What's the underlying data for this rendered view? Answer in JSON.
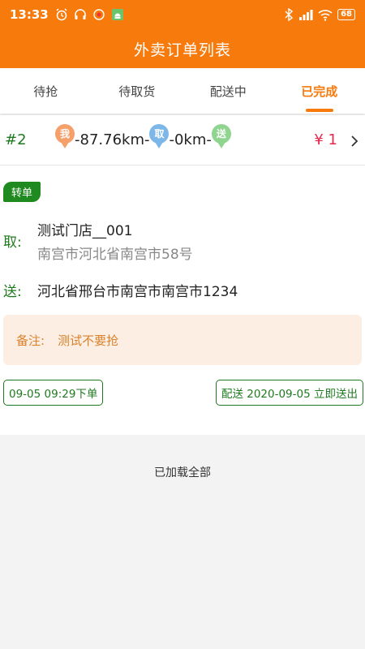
{
  "status_bar": {
    "time": "13:33",
    "battery": "68",
    "icons": [
      "alarm-icon",
      "headphones-icon",
      "notification-icon",
      "android-icon",
      "bluetooth-icon",
      "signal-icon",
      "wifi-icon",
      "battery-icon"
    ]
  },
  "app_bar": {
    "title": "外卖订单列表"
  },
  "tabs": [
    {
      "label": "待抢",
      "active": false
    },
    {
      "label": "待取货",
      "active": false
    },
    {
      "label": "配送中",
      "active": false
    },
    {
      "label": "已完成",
      "active": true
    }
  ],
  "order": {
    "number": "#2",
    "route": {
      "me_pin": "我",
      "distance_to_pickup": "-87.76km-",
      "pickup_pin": "取",
      "distance_to_dropoff": "-0km-",
      "dropoff_pin": "送"
    },
    "price": "¥ 1",
    "badge": "转单",
    "pickup": {
      "label": "取:",
      "store": "测试门店__001",
      "address": "南宫市河北省南宫市58号"
    },
    "dropoff": {
      "label": "送:",
      "address": "河北省邢台市南宫市南宫市1234"
    },
    "remark": {
      "label": "备注:",
      "value": "测试不要抢"
    },
    "order_time": "09-05 09:29下单",
    "delivery_time": "配送 2020-09-05 立即送出"
  },
  "footer": {
    "loaded_text": "已加载全部"
  },
  "colors": {
    "brand": "#f77a0c",
    "green": "#1f7a1f",
    "price": "#e5274b",
    "remark_bg": "#fdeee4"
  }
}
